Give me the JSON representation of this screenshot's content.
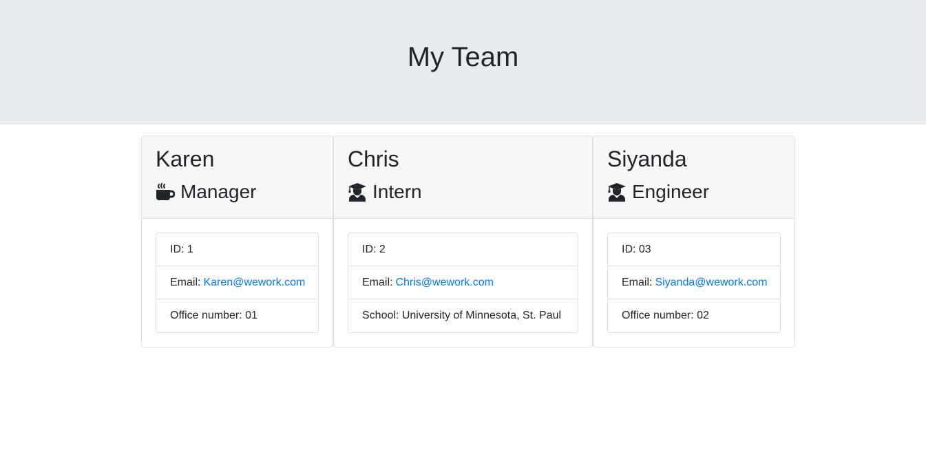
{
  "header": {
    "title": "My Team"
  },
  "colors": {
    "jumbotron": "#e9ecef",
    "link": "#007bff",
    "text": "#212529"
  },
  "members": [
    {
      "name": "Karen",
      "role": "Manager",
      "role_icon": "coffee-mug-icon",
      "id_label": "ID:",
      "id": "1",
      "email_label": "Email:",
      "email": "Karen@wework.com",
      "extra_label": "Office number:",
      "extra": "01"
    },
    {
      "name": "Chris",
      "role": "Intern",
      "role_icon": "graduate-icon",
      "id_label": "ID:",
      "id": "2",
      "email_label": "Email:",
      "email": "Chris@wework.com",
      "extra_label": "School:",
      "extra": "University of Minnesota, St. Paul"
    },
    {
      "name": "Siyanda",
      "role": "Engineer",
      "role_icon": "graduate-icon",
      "id_label": "ID:",
      "id": "03",
      "email_label": "Email:",
      "email": "Siyanda@wework.com",
      "extra_label": "Office number:",
      "extra": "02"
    }
  ]
}
